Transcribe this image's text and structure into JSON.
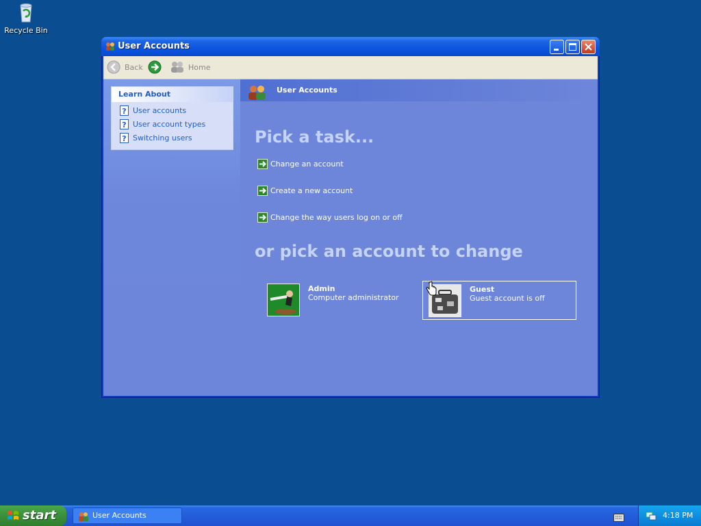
{
  "desktop": {
    "recycle_bin_label": "Recycle Bin",
    "icon_names": [
      "recycle-bin-icon"
    ]
  },
  "window": {
    "title": "User Accounts",
    "title_icon": "user-accounts-icon",
    "toolbar": {
      "back_label": "Back",
      "forward_icon": "forward-arrow-icon",
      "home_label": "Home"
    },
    "left_pane": {
      "panel_title": "Learn About",
      "items": [
        {
          "label": "User accounts",
          "icon": "help-icon"
        },
        {
          "label": "User account types",
          "icon": "help-icon"
        },
        {
          "label": "Switching users",
          "icon": "help-icon"
        }
      ]
    },
    "main": {
      "header_title": "User Accounts",
      "heading_tasks": "Pick a task...",
      "tasks": [
        {
          "label": "Change an account",
          "icon": "green-arrow-icon"
        },
        {
          "label": "Create a new account",
          "icon": "green-arrow-icon"
        },
        {
          "label": "Change the way users log on or off",
          "icon": "green-arrow-icon"
        }
      ],
      "heading_accounts": "or pick an account to change",
      "accounts": [
        {
          "name": "Admin",
          "description": "Computer administrator",
          "picture": "skateboarder-picture"
        },
        {
          "name": "Guest",
          "description": "Guest account is off",
          "picture": "suitcase-picture"
        }
      ]
    }
  },
  "taskbar": {
    "start_label": "start",
    "task_button_label": "User Accounts",
    "clock": "4:18 PM",
    "tray_icons": [
      "keyboard-icon",
      "network-icon"
    ]
  },
  "colors": {
    "desktop": "#0a4d91",
    "titlebar": "#0b54de",
    "content": "#6e86da",
    "start_green": "#3b8f3b",
    "link_blue": "#215dc6"
  }
}
